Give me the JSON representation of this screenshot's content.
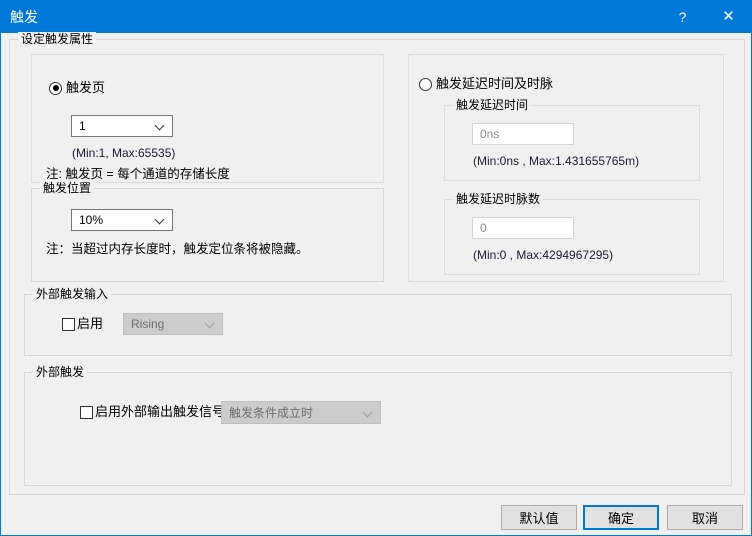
{
  "window": {
    "title": "触发",
    "help_icon": "?",
    "close_icon": "✕",
    "accent_color": "#0078d7",
    "background_color": "#f0f0f0"
  },
  "main_group": {
    "label": "设定触发属性"
  },
  "trigger_page": {
    "radio_label": "触发页",
    "radio_selected": true,
    "combo_value": "1",
    "range_hint": "(Min:1, Max:65535)",
    "note": "注: 触发页 = 每个通道的存储长度"
  },
  "trigger_position": {
    "label": "触发位置",
    "combo_value": "10%",
    "note": "注：当超过内存长度时，触发定位条将被隐藏。"
  },
  "trigger_delay": {
    "radio_label": "触发延迟时间及时脉",
    "radio_selected": false,
    "time_group_label": "触发延迟时间",
    "time_value": "0ns",
    "time_range_hint": "(Min:0ns , Max:1.431655765m)",
    "clock_group_label": "触发延迟时脉数",
    "clock_value": "0",
    "clock_range_hint": "(Min:0 , Max:4294967295)"
  },
  "external_trigger_input": {
    "label": "外部触发输入",
    "checkbox_label": "启用",
    "checkbox_checked": false,
    "combo_value": "Rising",
    "combo_disabled": true
  },
  "external_trigger_output": {
    "label": "外部触发",
    "checkbox_label": "启用外部输出触发信号",
    "checkbox_checked": false,
    "combo_value": "触发条件成立时",
    "combo_disabled": true
  },
  "footer": {
    "default_button": "默认值",
    "ok_button": "确定",
    "cancel_button": "取消"
  }
}
